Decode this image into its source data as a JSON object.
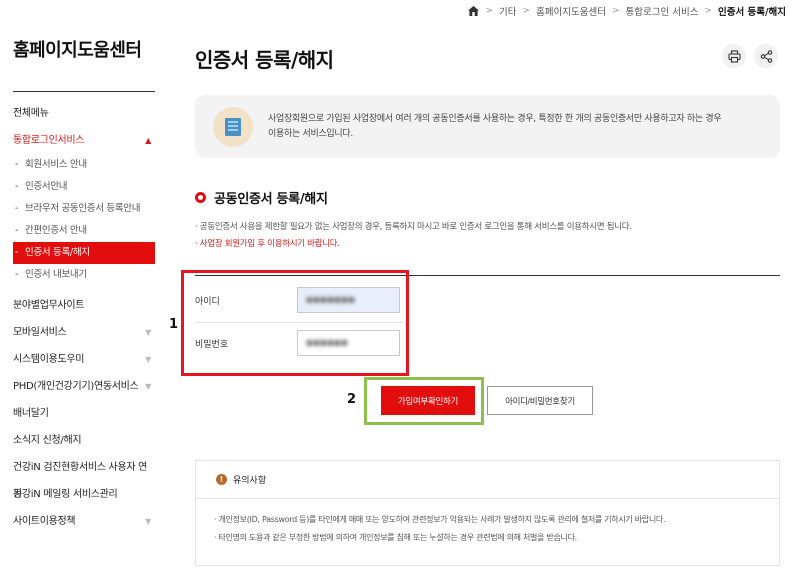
{
  "breadcrumb": {
    "home_icon": "home-icon",
    "items": [
      "기타",
      "홈페이지도움센터",
      "통합로그인 서비스"
    ],
    "current": "인증서 등록/해지"
  },
  "sidebar": {
    "title": "홈페이지도움센터",
    "items": [
      {
        "label": "전체메뉴"
      },
      {
        "label": "통합로그인서비스"
      },
      {
        "label": "분야별업무사이트"
      },
      {
        "label": "모바일서비스"
      },
      {
        "label": "시스템이용도우미"
      },
      {
        "label": "PHD(개인건강기기)연동서비스"
      },
      {
        "label": "배너달기"
      },
      {
        "label": "소식지 신청/해지"
      },
      {
        "label": "건강iN 검진현황서비스 사용자 연동"
      },
      {
        "label": "건강iN 메일링 서비스관리"
      },
      {
        "label": "사이트이용정책"
      }
    ],
    "sub_items": [
      {
        "label": "회원서비스 안내"
      },
      {
        "label": "인증서안내"
      },
      {
        "label": "브라우저 공동인증서 등록안내"
      },
      {
        "label": "간편인증서 안내"
      },
      {
        "label": "인증서 등록/해지"
      },
      {
        "label": "인증서 내보내기"
      }
    ]
  },
  "page": {
    "title": "인증서 등록/해지"
  },
  "intro": {
    "line1": "사업장회원으로 가입된 사업장에서 여러 개의 공동인증서를 사용하는 경우, 특정한 한 개의 공동인증서만 사용하고자 하는 경우",
    "line2": "이용하는 서비스입니다."
  },
  "section": {
    "title": "공동인증서 등록/해지",
    "note1": "· 공동인증서 사용을 제한할 필요가 없는 사업장의 경우, 등록하지 마시고 바로 인증서 로그인을 통해 서비스를 이용하시면 됩니다.",
    "note2": "· 사업장 회원가입 후 이용하시기 바랍니다."
  },
  "form": {
    "id_label": "아이디",
    "id_value": "●●●●●●●",
    "pw_label": "비밀번호",
    "pw_value": "●●●●●●"
  },
  "markers": {
    "one": "1",
    "two": "2"
  },
  "buttons": {
    "check_label": "가입여부확인하기",
    "find_label": "아이디/비밀번호찾기"
  },
  "caution": {
    "title": "유의사항",
    "item1": "· 개인정보(ID, Password 등)를 타인에게 매매 또는 양도하여 관련정보가 악용되는 사례가 발생하지 않도록 관리에 철저를 기하시기 바랍니다.",
    "item2": "· 타인명의 도용과 같은 부정한 방법에 의하여 개인정보를 침해 또는 누설하는 경우 관련법에 의해 처벌을 받습니다."
  },
  "colors": {
    "accent": "#e20d0d",
    "highlight_red": "#e8141e",
    "highlight_green": "#8ec14c"
  }
}
